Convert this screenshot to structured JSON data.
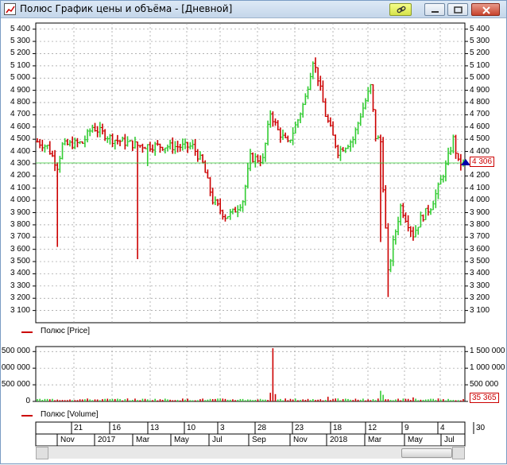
{
  "window": {
    "title": "Полюс График цены и объёма - [Дневной]",
    "buttons": {
      "link": "link-icon",
      "minimize": "minimize-icon",
      "maximize": "maximize-icon",
      "close": "close-icon"
    }
  },
  "legends": {
    "price": "Полюс [Price]",
    "volume": "Полюс [Volume]"
  },
  "current": {
    "price_label": "4 306",
    "volume_label": "35 365",
    "price_value": 4306
  },
  "colors": {
    "up": "#33cc33",
    "down": "#cc0000",
    "grid": "#999999",
    "marker": "#0000aa"
  },
  "timeline": {
    "days": [
      "21",
      "16",
      "13",
      "10",
      "3",
      "28",
      "23",
      "18",
      "12",
      "9",
      "4",
      "30"
    ],
    "months": [
      "Nov",
      "2017",
      "Mar",
      "May",
      "Jul",
      "Sep",
      "Nov",
      "2018",
      "Mar",
      "May",
      "Jul"
    ]
  },
  "chart_data": [
    {
      "type": "bar",
      "title": "",
      "ylim": [
        3000,
        5450
      ],
      "ticks": [
        "5 400",
        "5 300",
        "5 200",
        "5 100",
        "5 000",
        "4 900",
        "4 800",
        "4 700",
        "4 600",
        "4 500",
        "4 400",
        "4 300",
        "4 200",
        "4 100",
        "4 000",
        "3 900",
        "3 800",
        "3 700",
        "3 600",
        "3 500",
        "3 400",
        "3 300",
        "3 200",
        "3 100"
      ],
      "tick_values": [
        5400,
        5300,
        5200,
        5100,
        5000,
        4900,
        4800,
        4700,
        4600,
        4500,
        4400,
        4300,
        4200,
        4100,
        4000,
        3900,
        3800,
        3700,
        3600,
        3500,
        3400,
        3300,
        3200,
        3100
      ],
      "series": [
        {
          "name": "Полюс [Price]",
          "anchors": [
            [
              0,
              4480
            ],
            [
              4,
              4440
            ],
            [
              8,
              4280
            ],
            [
              10,
              4450
            ],
            [
              18,
              4470
            ],
            [
              22,
              4600
            ],
            [
              30,
              4500
            ],
            [
              40,
              4450
            ],
            [
              55,
              4440
            ],
            [
              62,
              4440
            ],
            [
              66,
              4300
            ],
            [
              70,
              4000
            ],
            [
              75,
              3870
            ],
            [
              78,
              3900
            ],
            [
              82,
              4000
            ],
            [
              85,
              4350
            ],
            [
              90,
              4330
            ],
            [
              93,
              4720
            ],
            [
              96,
              4570
            ],
            [
              100,
              4460
            ],
            [
              104,
              4660
            ],
            [
              107,
              4840
            ],
            [
              110,
              5150
            ],
            [
              112,
              5000
            ],
            [
              115,
              4700
            ],
            [
              120,
              4400
            ],
            [
              126,
              4500
            ],
            [
              129,
              4700
            ],
            [
              133,
              4930
            ],
            [
              135,
              4520
            ],
            [
              137,
              4480
            ],
            [
              140,
              3400
            ],
            [
              142,
              3650
            ],
            [
              145,
              3950
            ],
            [
              150,
              3720
            ],
            [
              153,
              3850
            ],
            [
              157,
              3950
            ],
            [
              160,
              4100
            ],
            [
              163,
              4280
            ],
            [
              166,
              4500
            ],
            [
              168,
              4306
            ]
          ],
          "spikes": [
            [
              8,
              3620
            ],
            [
              40,
              3520
            ],
            [
              44,
              4280
            ],
            [
              137,
              3660
            ],
            [
              140,
              3210
            ]
          ]
        }
      ]
    },
    {
      "type": "bar",
      "title": "",
      "ylim": [
        0,
        1650000
      ],
      "ticks": [
        "1 500 000",
        "1 000 000",
        "500 000",
        "0"
      ],
      "tick_values": [
        1500000,
        1000000,
        500000,
        0
      ],
      "series": [
        {
          "name": "Полюс [Volume]",
          "baseline": 60000,
          "spikes": [
            [
              94,
              1600000
            ],
            [
              93,
              260000
            ],
            [
              95,
              220000
            ],
            [
              116,
              140000
            ],
            [
              137,
              320000
            ],
            [
              138,
              200000
            ],
            [
              150,
              120000
            ]
          ]
        }
      ]
    }
  ]
}
